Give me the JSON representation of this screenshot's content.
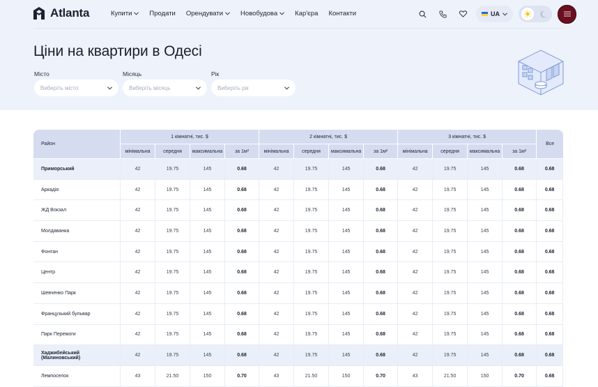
{
  "brand": {
    "name": "Atlanta"
  },
  "nav": {
    "items": [
      {
        "label": "Купити",
        "dropdown": true
      },
      {
        "label": "Продати",
        "dropdown": false
      },
      {
        "label": "Орендувати",
        "dropdown": true
      },
      {
        "label": "Новобудова",
        "dropdown": true
      },
      {
        "label": "Кар'єра",
        "dropdown": false
      },
      {
        "label": "Контакти",
        "dropdown": false
      }
    ],
    "language": "UA",
    "icons": [
      "search-icon",
      "phone-icon",
      "heart-icon"
    ]
  },
  "page": {
    "title": "Ціни на квартири в Одесі"
  },
  "filters": [
    {
      "label": "Місто",
      "placeholder": "Виберіть місто"
    },
    {
      "label": "Місяць",
      "placeholder": "Виберіть місяць"
    },
    {
      "label": "Рік",
      "placeholder": "Виберіть рік"
    }
  ],
  "table": {
    "rayon_header": "Район",
    "groups": [
      "1 кімнатні, тис. $",
      "2 кімнатні, тис. $",
      "3 кімнатні, тис. $"
    ],
    "sub_headers": [
      "мінімальна",
      "середня",
      "максимальна",
      "за 1м²"
    ],
    "all_header": "Все",
    "rows": [
      {
        "name": "Приморський",
        "highlight": true,
        "g": [
          [
            "42",
            "19.75",
            "145",
            "0.68"
          ],
          [
            "42",
            "19.75",
            "145",
            "0.68"
          ],
          [
            "42",
            "19.75",
            "145",
            "0.68"
          ]
        ],
        "all": "0.68"
      },
      {
        "name": "Аркадія",
        "highlight": false,
        "g": [
          [
            "42",
            "19.75",
            "145",
            "0.68"
          ],
          [
            "42",
            "19.75",
            "145",
            "0.68"
          ],
          [
            "42",
            "19.75",
            "145",
            "0.68"
          ]
        ],
        "all": "0.68"
      },
      {
        "name": "ЖД Вокзал",
        "highlight": false,
        "g": [
          [
            "42",
            "19.75",
            "145",
            "0.68"
          ],
          [
            "42",
            "19.75",
            "145",
            "0.68"
          ],
          [
            "42",
            "19.75",
            "145",
            "0.68"
          ]
        ],
        "all": "0.68"
      },
      {
        "name": "Молдаванка",
        "highlight": false,
        "g": [
          [
            "42",
            "19.75",
            "145",
            "0.68"
          ],
          [
            "42",
            "19.75",
            "145",
            "0.68"
          ],
          [
            "42",
            "19.75",
            "145",
            "0.68"
          ]
        ],
        "all": "0.68"
      },
      {
        "name": "Фонтан",
        "highlight": false,
        "g": [
          [
            "42",
            "19.75",
            "145",
            "0.68"
          ],
          [
            "42",
            "19.75",
            "145",
            "0.68"
          ],
          [
            "42",
            "19.75",
            "145",
            "0.68"
          ]
        ],
        "all": "0.68"
      },
      {
        "name": "Центр",
        "highlight": false,
        "g": [
          [
            "42",
            "19.75",
            "145",
            "0.68"
          ],
          [
            "42",
            "19.75",
            "145",
            "0.68"
          ],
          [
            "42",
            "19.75",
            "145",
            "0.68"
          ]
        ],
        "all": "0.68"
      },
      {
        "name": "Шевченко Парк",
        "highlight": false,
        "g": [
          [
            "42",
            "19.75",
            "145",
            "0.68"
          ],
          [
            "42",
            "19.75",
            "145",
            "0.68"
          ],
          [
            "42",
            "19.75",
            "145",
            "0.68"
          ]
        ],
        "all": "0.68"
      },
      {
        "name": "Французький бульвар",
        "highlight": false,
        "g": [
          [
            "42",
            "19.75",
            "145",
            "0.68"
          ],
          [
            "42",
            "19.75",
            "145",
            "0.68"
          ],
          [
            "42",
            "19.75",
            "145",
            "0.68"
          ]
        ],
        "all": "0.68"
      },
      {
        "name": "Парк Перемоги",
        "highlight": false,
        "g": [
          [
            "42",
            "19.75",
            "145",
            "0.68"
          ],
          [
            "42",
            "19.75",
            "145",
            "0.68"
          ],
          [
            "42",
            "19.75",
            "145",
            "0.68"
          ]
        ],
        "all": "0.68"
      },
      {
        "name": "Хаджибейський (Малиновський)",
        "highlight": true,
        "g": [
          [
            "42",
            "19.75",
            "145",
            "0.68"
          ],
          [
            "42",
            "19.75",
            "145",
            "0.68"
          ],
          [
            "42",
            "19.75",
            "145",
            "0.68"
          ]
        ],
        "all": "0.68"
      },
      {
        "name": "Лемпоселок",
        "highlight": false,
        "g": [
          [
            "43",
            "21.50",
            "150",
            "0.70"
          ],
          [
            "43",
            "21.50",
            "150",
            "0.70"
          ],
          [
            "43",
            "21.50",
            "150",
            "0.70"
          ]
        ],
        "all": "0.68"
      }
    ]
  },
  "colors": {
    "accent": "#6b0f1f",
    "headerBg": "#eef2fb",
    "tableHeader": "#d5dcf0"
  }
}
